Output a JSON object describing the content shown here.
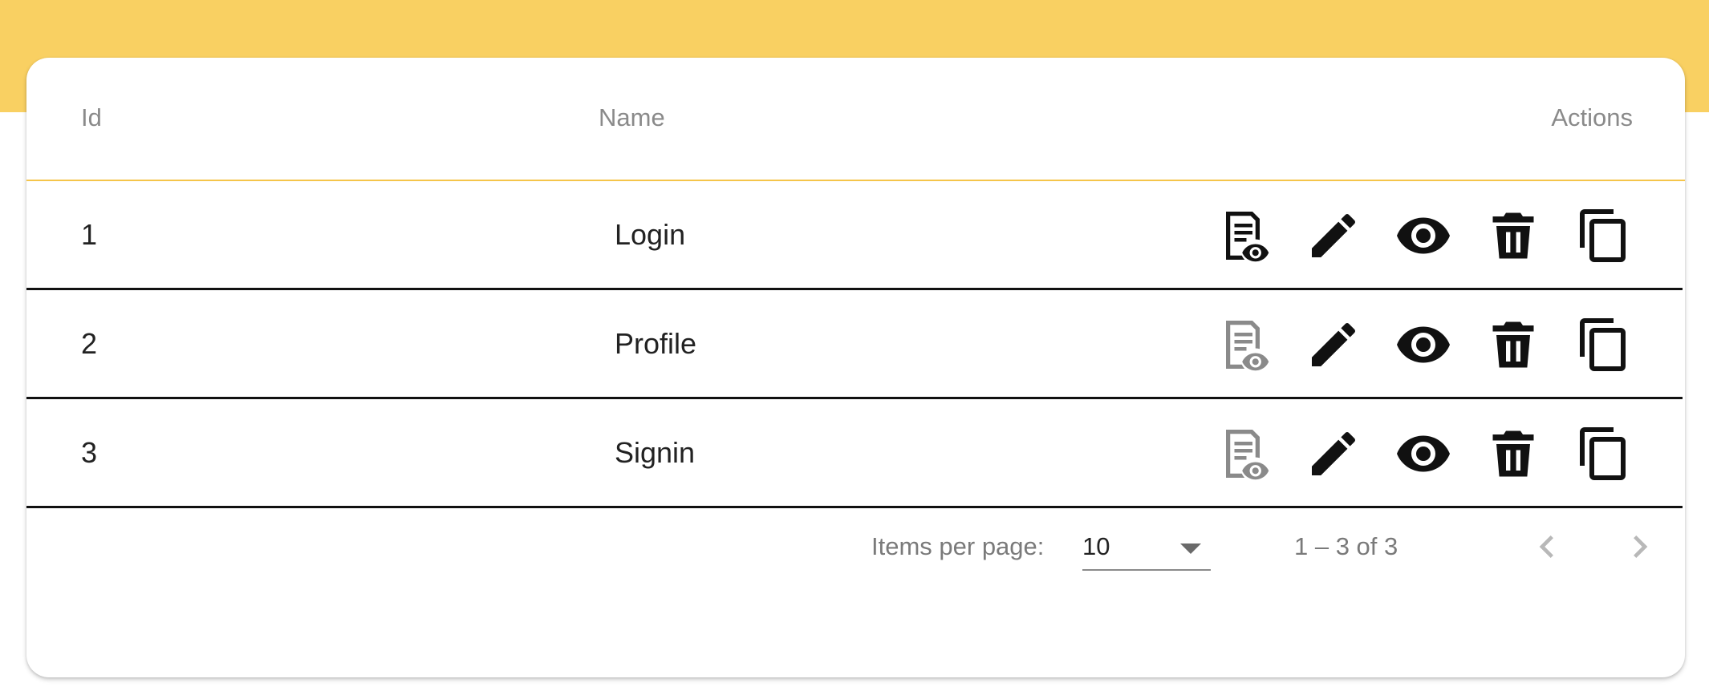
{
  "colors": {
    "accent_band": "#f9d062",
    "header_divider": "#f5c54a",
    "icon_active": "#111111",
    "icon_disabled": "#8a8a8a"
  },
  "table": {
    "headers": {
      "id": "Id",
      "name": "Name",
      "actions": "Actions"
    },
    "rows": [
      {
        "id": "1",
        "name": "Login",
        "actions": [
          {
            "icon": "document-preview-icon",
            "enabled": true
          },
          {
            "icon": "edit-pencil-icon",
            "enabled": true
          },
          {
            "icon": "view-eye-icon",
            "enabled": true
          },
          {
            "icon": "delete-trash-icon",
            "enabled": true
          },
          {
            "icon": "copy-icon",
            "enabled": true
          }
        ]
      },
      {
        "id": "2",
        "name": "Profile",
        "actions": [
          {
            "icon": "document-preview-icon",
            "enabled": false
          },
          {
            "icon": "edit-pencil-icon",
            "enabled": true
          },
          {
            "icon": "view-eye-icon",
            "enabled": true
          },
          {
            "icon": "delete-trash-icon",
            "enabled": true
          },
          {
            "icon": "copy-icon",
            "enabled": true
          }
        ]
      },
      {
        "id": "3",
        "name": "Signin",
        "actions": [
          {
            "icon": "document-preview-icon",
            "enabled": false
          },
          {
            "icon": "edit-pencil-icon",
            "enabled": true
          },
          {
            "icon": "view-eye-icon",
            "enabled": true
          },
          {
            "icon": "delete-trash-icon",
            "enabled": true
          },
          {
            "icon": "copy-icon",
            "enabled": true
          }
        ]
      }
    ]
  },
  "paginator": {
    "items_per_page_label": "Items per page:",
    "items_per_page_value": "10",
    "range_label": "1 – 3 of 3",
    "prev_icon": "chevron-left-icon",
    "next_icon": "chevron-right-icon"
  }
}
